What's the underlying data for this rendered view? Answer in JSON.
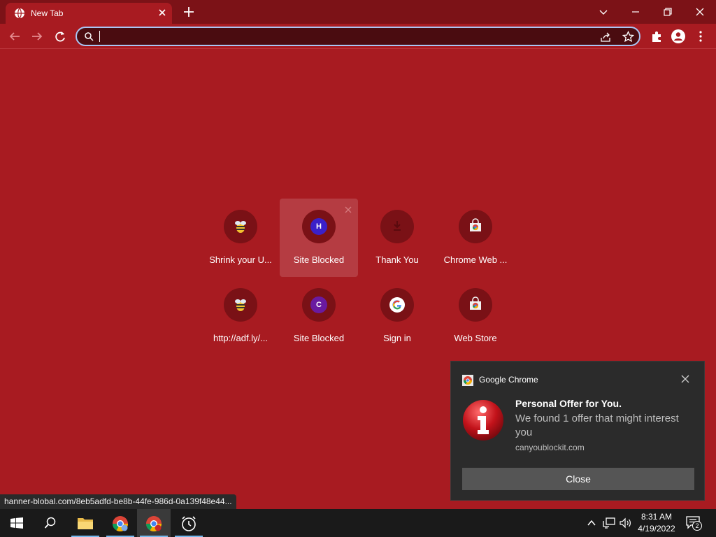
{
  "browser": {
    "tab_title": "New Tab",
    "omnibox_value": "",
    "accent": "#a81b21"
  },
  "shortcuts": [
    {
      "label": "Shrink your U...",
      "icon": "bee-icon"
    },
    {
      "label": "Site Blocked",
      "icon": "letter-h-icon",
      "letter": "H"
    },
    {
      "label": "Thank You",
      "icon": "download-icon"
    },
    {
      "label": "Chrome Web ...",
      "icon": "chrome-web-store-icon"
    },
    {
      "label": "http://adf.ly/...",
      "icon": "bee-icon"
    },
    {
      "label": "Site Blocked",
      "icon": "letter-c-icon",
      "letter": "C"
    },
    {
      "label": "Sign in",
      "icon": "google-icon"
    },
    {
      "label": "Web Store",
      "icon": "chrome-web-store-icon"
    }
  ],
  "status_url": "hanner-blobal.com/8eb5adfd-be8b-44fe-986d-0a139f48e44...",
  "notification": {
    "app": "Google Chrome",
    "title": "Personal Offer for You.",
    "body": "We found 1 offer that might interest you",
    "source": "canyoublockit.com",
    "button": "Close"
  },
  "taskbar": {
    "time": "8:31 AM",
    "date": "4/19/2022",
    "notifications_count": "2"
  }
}
